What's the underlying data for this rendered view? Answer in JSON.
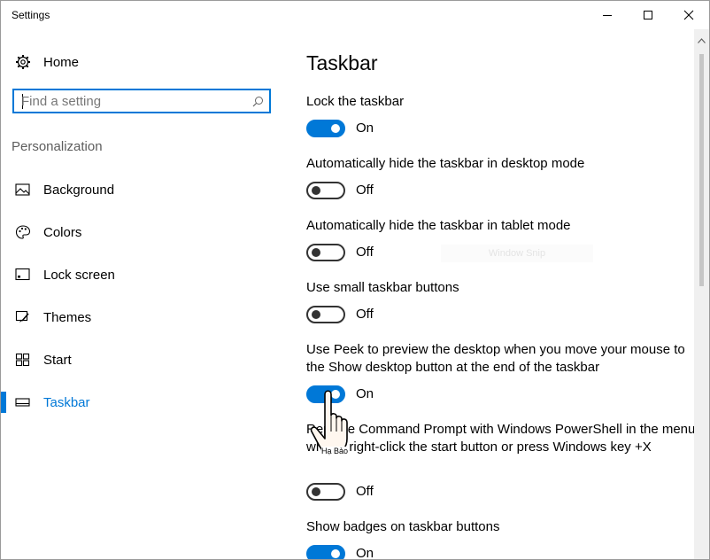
{
  "window": {
    "title": "Settings"
  },
  "sidebar": {
    "home_label": "Home",
    "search": {
      "placeholder": "Find a setting"
    },
    "section_label": "Personalization",
    "items": [
      {
        "label": "Background",
        "icon": "picture-icon"
      },
      {
        "label": "Colors",
        "icon": "palette-icon"
      },
      {
        "label": "Lock screen",
        "icon": "lock-screen-icon"
      },
      {
        "label": "Themes",
        "icon": "brush-icon"
      },
      {
        "label": "Start",
        "icon": "start-grid-icon"
      },
      {
        "label": "Taskbar",
        "icon": "taskbar-icon",
        "active": true
      }
    ]
  },
  "main": {
    "title": "Taskbar",
    "settings": [
      {
        "label": "Lock the taskbar",
        "state": "On"
      },
      {
        "label": "Automatically hide the taskbar in desktop mode",
        "state": "Off"
      },
      {
        "label": "Automatically hide the taskbar in tablet mode",
        "state": "Off"
      },
      {
        "label": "Use small taskbar buttons",
        "state": "Off"
      },
      {
        "label": "Use Peek to preview the desktop when you move your mouse to the Show desktop button at the end of the taskbar",
        "state": "On"
      },
      {
        "label": "Replace Command Prompt with Windows PowerShell in the menu when I right-click the start button or press Windows key +X",
        "state": "Off"
      },
      {
        "label": "Show badges on taskbar buttons",
        "state": "On"
      }
    ]
  },
  "overlay": {
    "ghost_text": "Window Snip",
    "cursor_tip": "Hạ Bảo"
  },
  "colors": {
    "accent": "#0078d7",
    "toggle_off": "#333333",
    "section_text": "#5d5d5d"
  }
}
